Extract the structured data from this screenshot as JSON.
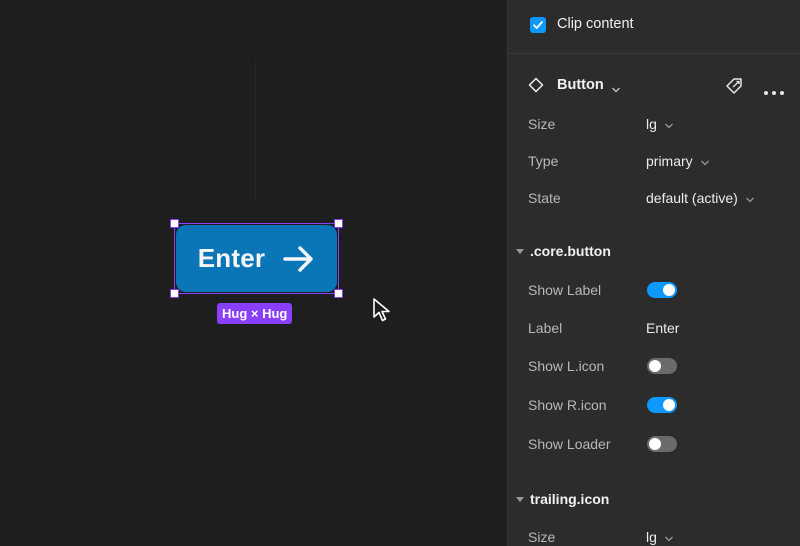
{
  "canvas": {
    "button_label": "Enter",
    "size_badge": "Hug × Hug"
  },
  "panel": {
    "clip_content": {
      "label": "Clip content",
      "checked": true
    },
    "component": {
      "name": "Button"
    },
    "props": [
      {
        "label": "Size",
        "value": "lg"
      },
      {
        "label": "Type",
        "value": "primary"
      },
      {
        "label": "State",
        "value": "default (active)"
      }
    ],
    "core_button": {
      "title": ".core.button",
      "show_label": {
        "label": "Show Label",
        "on": true
      },
      "label_prop": {
        "label": "Label",
        "value": "Enter"
      },
      "show_licon": {
        "label": "Show L.icon",
        "on": false
      },
      "show_ricon": {
        "label": "Show R.icon",
        "on": true
      },
      "show_loader": {
        "label": "Show Loader",
        "on": false
      }
    },
    "trailing_icon": {
      "title": "trailing.icon",
      "size": {
        "label": "Size",
        "value": "lg"
      }
    }
  },
  "colors": {
    "selection": "#8a3ffc",
    "button_fill": "#0a76b8",
    "toggle_on": "#0d99ff",
    "toggle_off": "#6b6b6b",
    "panel_bg": "#2c2c2c",
    "canvas_bg": "#1e1e1e"
  },
  "icons": {
    "checkbox": "check-icon",
    "component": "component-diamond-icon",
    "detach": "detach-instance-icon",
    "more": "more-horizontal-icon",
    "arrow": "arrow-right-icon",
    "cursor": "mouse-pointer-icon"
  }
}
